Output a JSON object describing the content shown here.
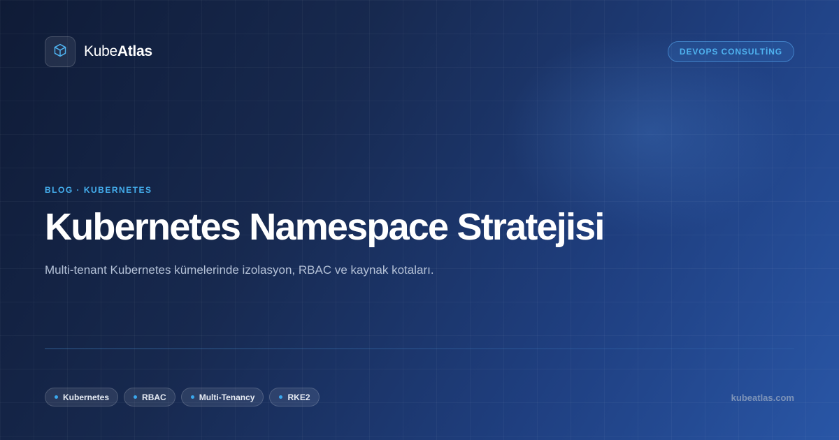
{
  "brand": {
    "name_regular": "Kube",
    "name_bold": "Atlas",
    "logo_icon": "cube-icon"
  },
  "badge": {
    "label": "DEVOPS CONSULTİNG"
  },
  "post": {
    "eyebrow": "BLOG · KUBERNETES",
    "title": "Kubernetes Namespace Stratejisi",
    "subtitle": "Multi-tenant Kubernetes kümelerinde izolasyon, RBAC ve kaynak kotaları."
  },
  "tags": [
    {
      "label": "Kubernetes"
    },
    {
      "label": "RBAC"
    },
    {
      "label": "Multi-Tenancy"
    },
    {
      "label": "RKE2"
    }
  ],
  "footer": {
    "url": "kubeatlas.com"
  },
  "colors": {
    "accent": "#45b0f0",
    "background_start": "#0f1b36",
    "background_end": "#2956a6",
    "subtitle": "#b3c0d6",
    "url": "#7d93b8"
  }
}
